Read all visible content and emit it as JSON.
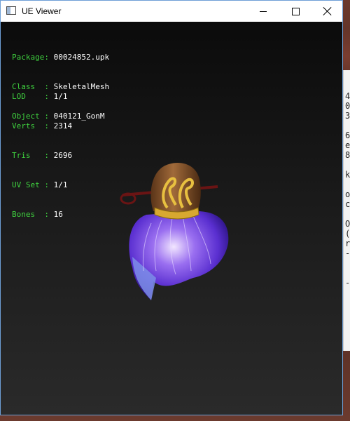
{
  "window": {
    "title": "UE Viewer",
    "icon": "app-window-icon",
    "controls": [
      "minimize-icon",
      "maximize-icon",
      "close-icon"
    ]
  },
  "info": {
    "package_key": "Package:",
    "package": "00024852.upk",
    "class_key": "Class  :",
    "class": "SkeletalMesh",
    "object_key": "Object :",
    "object": "040121_GonM",
    "lod_key": "LOD    :",
    "lod": "1/1",
    "verts_key": "Verts  :",
    "verts": "2314",
    "tris_key": "Tris   :",
    "tris": "2696",
    "uvset_key": "UV Set :",
    "uvset": "1/1",
    "bones_key": "Bones  :",
    "bones": "16"
  },
  "background_window_text": [
    "4",
    "0",
    "3",
    "",
    "6",
    "e",
    "8",
    "",
    "k",
    "",
    "o",
    "c",
    "",
    "O",
    "(",
    "r",
    "-",
    "",
    "",
    "-",
    "",
    ""
  ],
  "colors": {
    "label_green": "#3fd23f",
    "value_white": "#ffffff",
    "viewport_top": "#0b0b0b",
    "viewport_bottom": "#2a2a2a",
    "feather_purple": "#7a4fe0"
  }
}
